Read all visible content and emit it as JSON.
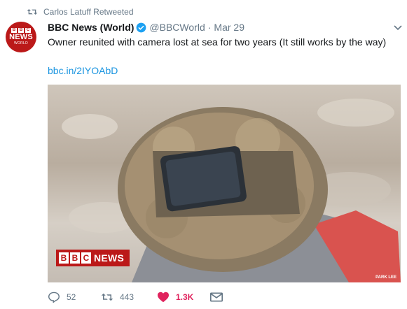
{
  "retweet_context": {
    "text": "Carlos Latuff Retweeted",
    "icon": "retweet-icon"
  },
  "author": {
    "avatar": {
      "blocks": [
        "B",
        "B",
        "C"
      ],
      "news": "NEWS",
      "world": "WORLD",
      "bg": "#bb1919"
    },
    "display_name": "BBC News (World)",
    "verified": true,
    "handle": "@BBCWorld",
    "separator": "·",
    "date": "Mar 29"
  },
  "tweet": {
    "text": "Owner reunited with camera lost at sea for two years (It still works by the way)",
    "link": "bbc.in/2IYOAbD"
  },
  "media": {
    "badge": {
      "blocks": [
        "B",
        "B",
        "C"
      ],
      "news": "NEWS"
    },
    "credit": "PARK LEE"
  },
  "actions": {
    "reply_count": "52",
    "retweet_count": "443",
    "like_count": "1.3K"
  },
  "colors": {
    "link": "#1b95e0",
    "like": "#e0245e",
    "muted": "#657786",
    "brand": "#bb1919"
  }
}
